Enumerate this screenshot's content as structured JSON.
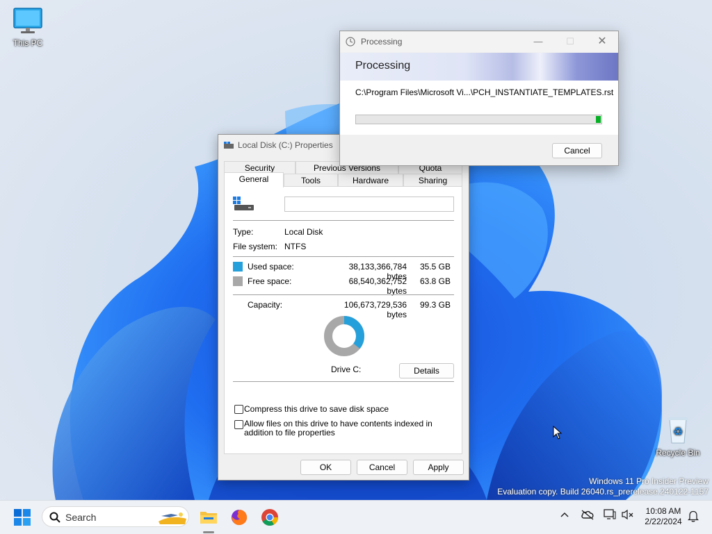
{
  "desktop": {
    "icons": [
      {
        "label": "This PC"
      },
      {
        "label": "Recycle Bin"
      }
    ],
    "watermark": {
      "line1": "Windows 11 Pro Insider Preview",
      "line2": "Evaluation copy. Build 26040.rs_prerelease.240122-1157"
    }
  },
  "properties": {
    "title": "Local Disk (C:) Properties",
    "tabs_row1": [
      "Security",
      "Previous Versions",
      "Quota"
    ],
    "tabs_row2": [
      "General",
      "Tools",
      "Hardware",
      "Sharing"
    ],
    "active_tab": "General",
    "drive_name_value": "",
    "type_label": "Type:",
    "type_value": "Local Disk",
    "fs_label": "File system:",
    "fs_value": "NTFS",
    "used": {
      "label": "Used space:",
      "bytes": "38,133,366,784 bytes",
      "size": "35.5 GB",
      "color": "#26a0da"
    },
    "free": {
      "label": "Free space:",
      "bytes": "68,540,362,752 bytes",
      "size": "63.8 GB",
      "color": "#a8a8a8"
    },
    "capacity": {
      "label": "Capacity:",
      "bytes": "106,673,729,536 bytes",
      "size": "99.3 GB"
    },
    "used_fraction": 0.357,
    "drive_label": "Drive C:",
    "details_button": "Details",
    "compress_label": "Compress this drive to save disk space",
    "index_label": "Allow files on this drive to have contents indexed in addition to file properties",
    "compress_checked": false,
    "index_checked": false,
    "buttons": {
      "ok": "OK",
      "cancel": "Cancel",
      "apply": "Apply"
    }
  },
  "processing": {
    "title": "Processing",
    "heading": "Processing",
    "path": "C:\\Program Files\\Microsoft Vi...\\PCH_INSTANTIATE_TEMPLATES.rst",
    "progress_fraction": 0.02,
    "cancel": "Cancel"
  },
  "taskbar": {
    "search_placeholder": "Search",
    "time": "10:08 AM",
    "date": "2/22/2024"
  },
  "colors": {
    "accent": "#0067c0",
    "progress": "#06b025"
  }
}
